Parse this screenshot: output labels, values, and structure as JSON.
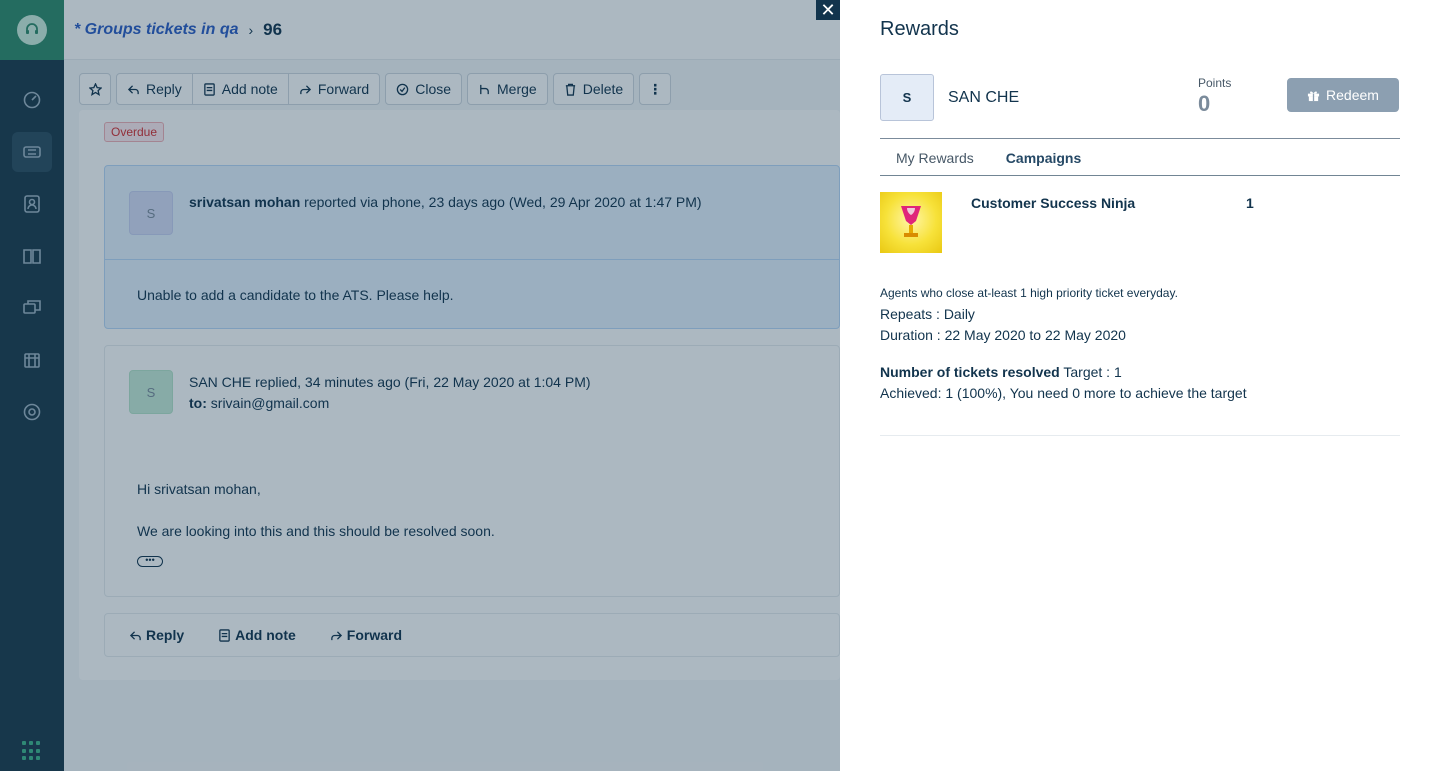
{
  "breadcrumb": {
    "link": "* Groups tickets in qa",
    "ticket_number": "96"
  },
  "toolbar": {
    "reply": "Reply",
    "add_note": "Add note",
    "forward": "Forward",
    "close": "Close",
    "merge": "Merge",
    "delete": "Delete"
  },
  "ticket": {
    "status_badge": "Overdue",
    "message1": {
      "avatar": "S",
      "author": "srivatsan mohan",
      "meta": "reported via phone, 23 days ago (Wed, 29 Apr 2020 at 1:47 PM)",
      "body": "Unable to add a candidate to the ATS. Please help."
    },
    "message2": {
      "avatar": "S",
      "author": "SAN CHE",
      "meta": "replied, 34 minutes ago (Fri, 22 May 2020 at 1:04 PM)",
      "to_label": "to:",
      "to_value": "srivain@gmail.com",
      "greeting": "Hi srivatsan mohan,",
      "body": "We are looking into this and this should be resolved soon."
    },
    "reply_bar": {
      "reply": "Reply",
      "add_note": "Add note",
      "forward": "Forward"
    }
  },
  "rewards": {
    "title": "Rewards",
    "user_avatar": "S",
    "user_name": "SAN CHE",
    "points_label": "Points",
    "points_value": "0",
    "redeem_label": "Redeem",
    "tabs": [
      {
        "label": "My Rewards",
        "active": false
      },
      {
        "label": "Campaigns",
        "active": true
      }
    ],
    "campaign": {
      "name": "Customer Success Ninja",
      "count": "1",
      "description": "Agents who close at-least 1 high priority ticket everyday.",
      "repeats": "Repeats : Daily",
      "duration": "Duration : 22 May 2020 to 22 May 2020",
      "criteria_label": "Number of tickets resolved",
      "criteria_target": " Target : 1",
      "achieved": "Achieved: 1 (100%), You need 0 more to achieve the target"
    }
  },
  "colors": {
    "sidebar": "#1b3a4b",
    "brand": "#2e8a6a",
    "link": "#2c5cc5",
    "overdue": "#d72d30",
    "redeem": "#8c9fb1"
  },
  "icons": [
    "headset-icon",
    "dashboard-icon",
    "tickets-icon",
    "contacts-icon",
    "solutions-icon",
    "forums-icon",
    "admin-icon",
    "settings-icon",
    "apps-icon",
    "close-icon",
    "gift-icon",
    "trophy-icon"
  ]
}
